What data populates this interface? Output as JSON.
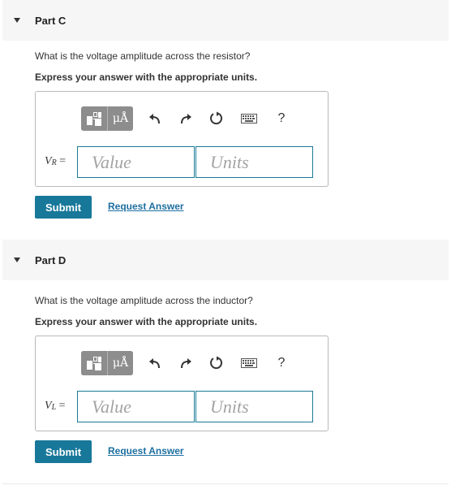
{
  "parts": [
    {
      "title": "Part C",
      "question": "What is the voltage amplitude across the resistor?",
      "instruction": "Express your answer with the appropriate units.",
      "variable": "V",
      "subscript": "R",
      "equals": "=",
      "value_placeholder": "Value",
      "units_placeholder": "Units",
      "submit_label": "Submit",
      "request_label": "Request Answer"
    },
    {
      "title": "Part D",
      "question": "What is the voltage amplitude across the inductor?",
      "instruction": "Express your answer with the appropriate units.",
      "variable": "V",
      "subscript": "L",
      "equals": "=",
      "value_placeholder": "Value",
      "units_placeholder": "Units",
      "submit_label": "Submit",
      "request_label": "Request Answer"
    }
  ],
  "toolbar": {
    "symbols_label": "μÅ",
    "help_label": "?",
    "icons": [
      "templates-icon",
      "symbols-icon",
      "undo-icon",
      "redo-icon",
      "reset-icon",
      "keyboard-icon",
      "help-icon"
    ]
  },
  "colors": {
    "accent": "#18789a",
    "link": "#1e6fa0",
    "toolbar_group": "#8d8d8d",
    "header_bg": "#f6f6f6"
  }
}
